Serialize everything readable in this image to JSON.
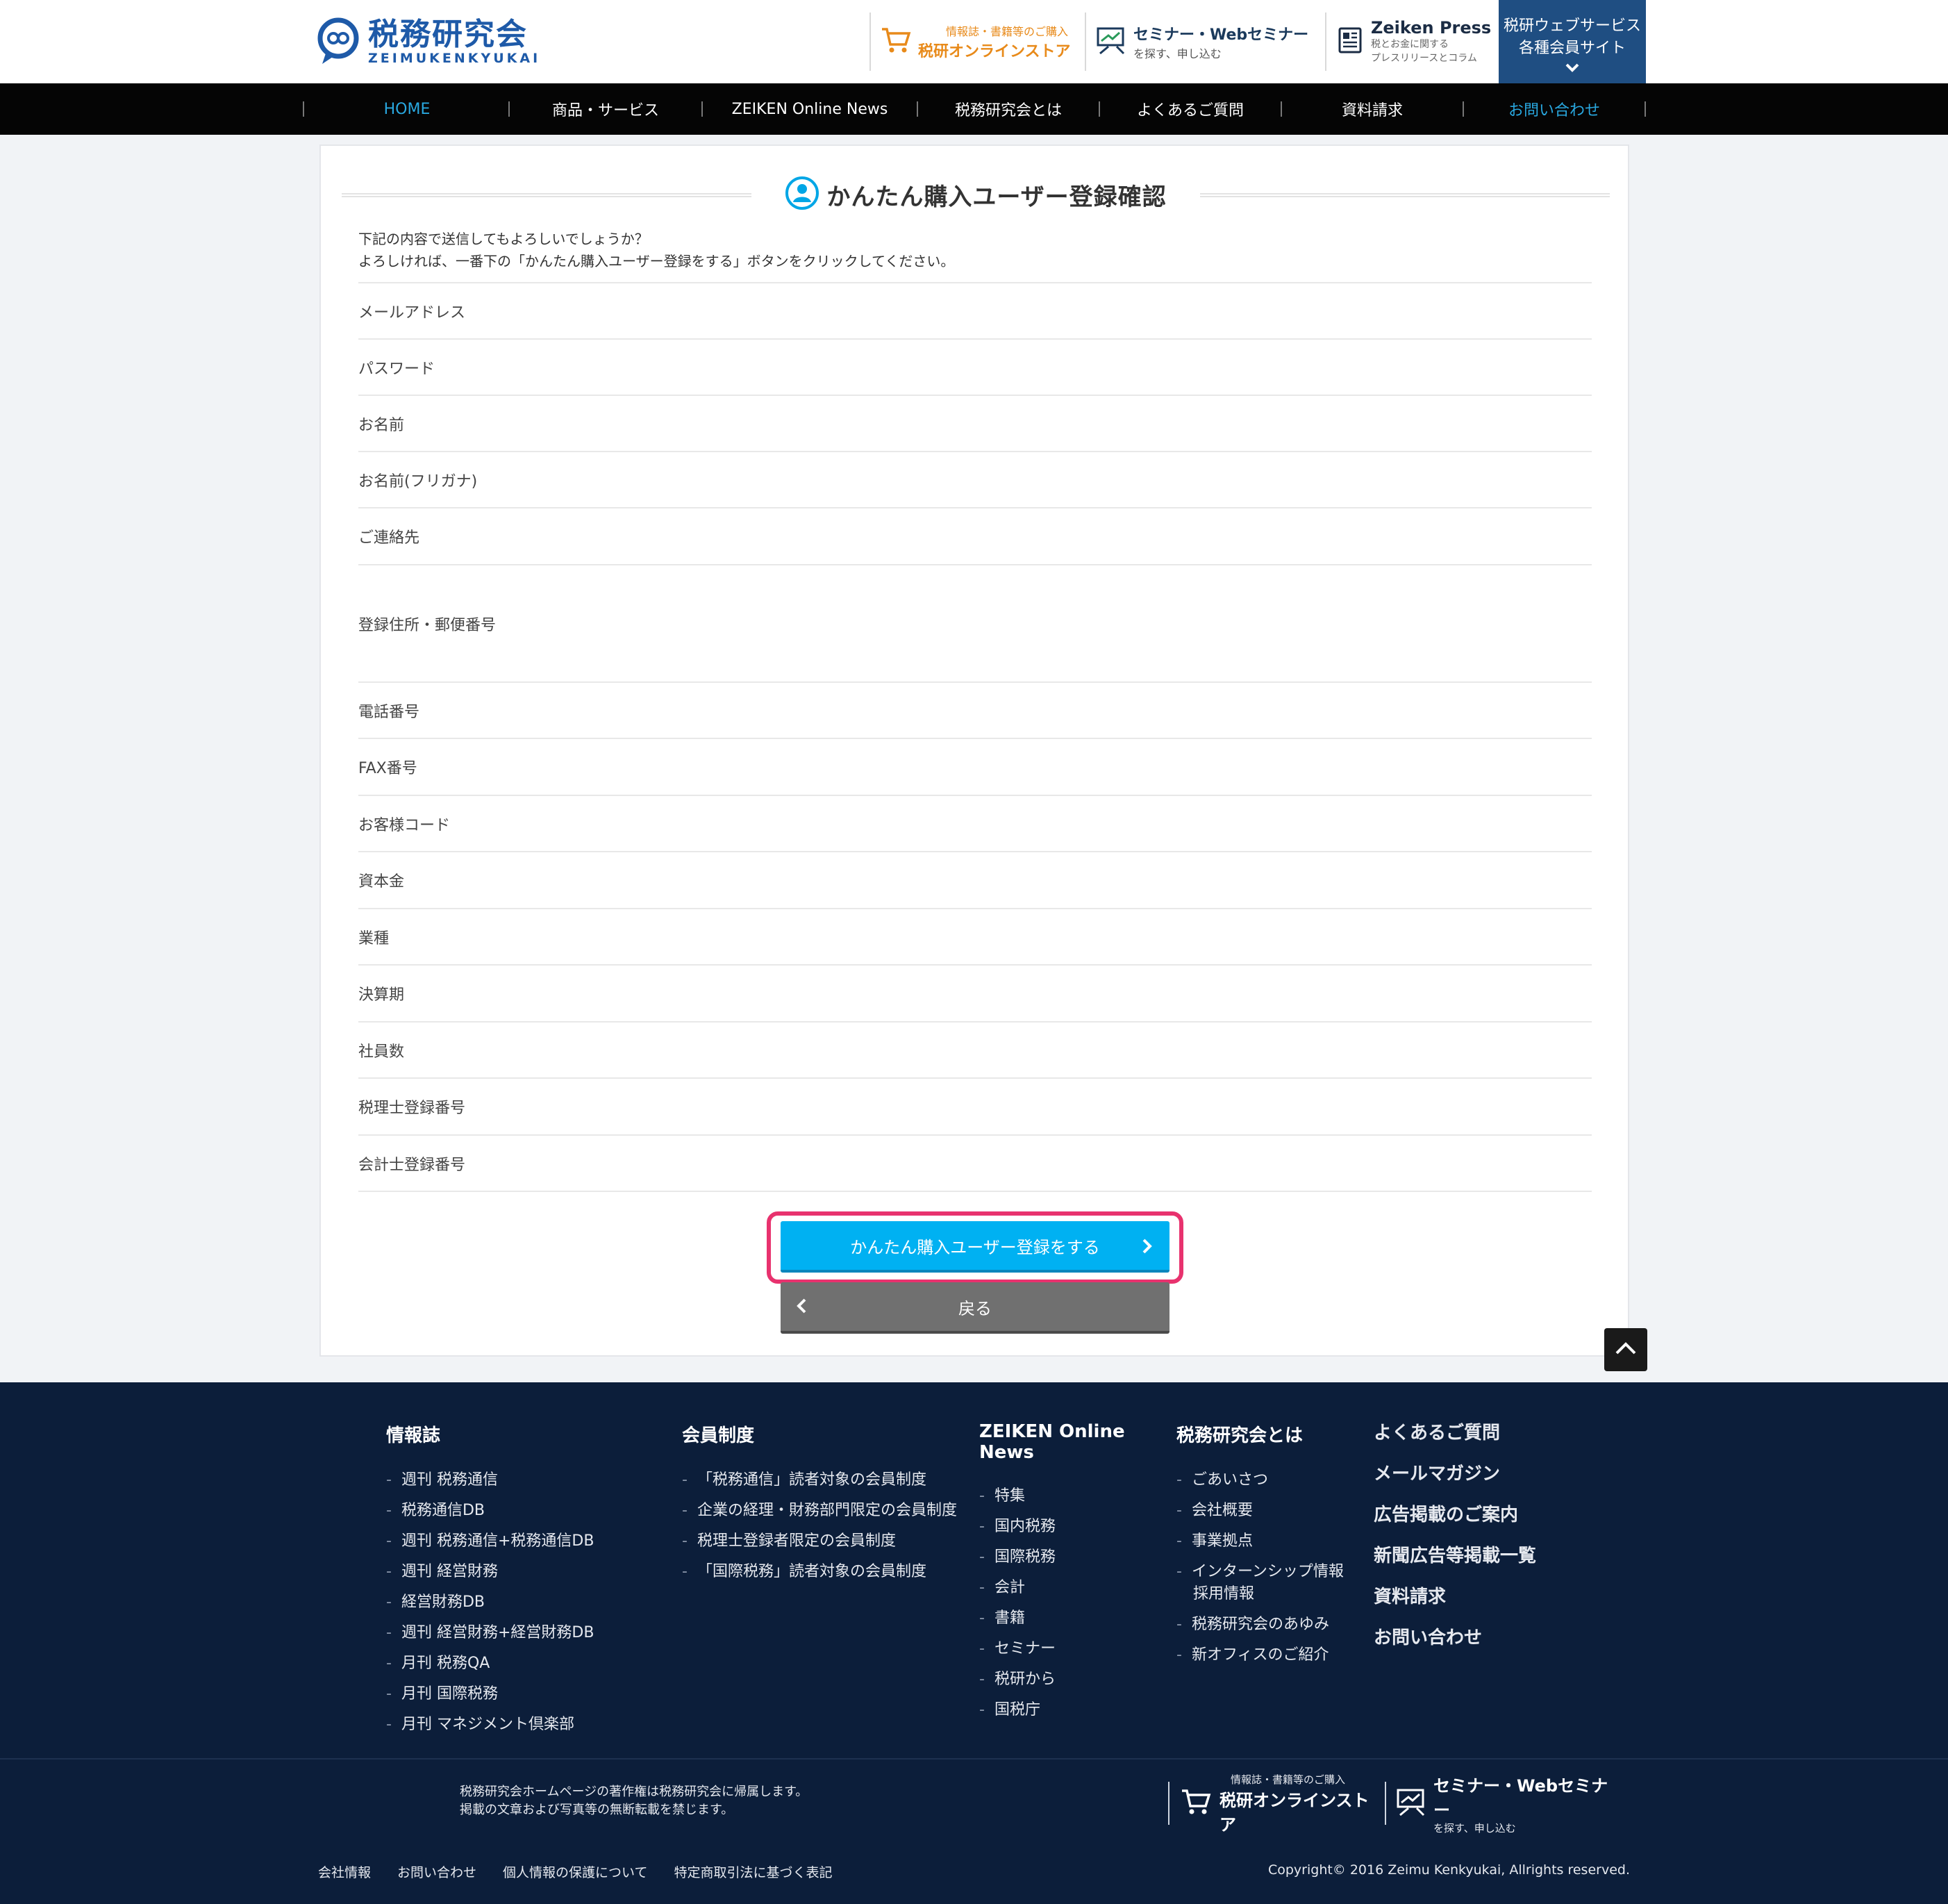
{
  "header": {
    "logo_jp": "税務研究会",
    "logo_en": "ZEIMUKENKYUKAI",
    "store_small": "情報誌・書籍等のご購入",
    "store_main": "税研オンラインストア",
    "seminar_main": "セミナー・Webセミナー",
    "seminar_small": "を探す、申し込む",
    "press_main": "Zeiken Press",
    "press_small1": "税とお金に関する",
    "press_small2": "プレスリリースとコラム",
    "web_line1": "税研ウェブサービス",
    "web_line2": "各種会員サイト"
  },
  "nav": [
    "HOME",
    "商品・サービス",
    "ZEIKEN Online News",
    "税務研究会とは",
    "よくあるご質問",
    "資料請求",
    "お問い合わせ"
  ],
  "main": {
    "title": "かんたん購入ユーザー登録確認",
    "intro1": "下記の内容で送信してもよろしいでしょうか？",
    "intro2": "よろしければ、一番下の「かんたん購入ユーザー登録をする」ボタンをクリックしてください。",
    "fields": [
      "メールアドレス",
      "パスワード",
      "お名前",
      "お名前(フリガナ)",
      "ご連絡先",
      "登録住所・郵便番号",
      "電話番号",
      "FAX番号",
      "お客様コード",
      "資本金",
      "業種",
      "決算期",
      "社員数",
      "税理士登録番号",
      "会計士登録番号"
    ],
    "submit_label": "かんたん購入ユーザー登録をする",
    "back_label": "戻る"
  },
  "footer": {
    "col1": {
      "title": "情報誌",
      "items": [
        "週刊 税務通信",
        "税務通信DB",
        "週刊 税務通信+税務通信DB",
        "週刊 経営財務",
        "経営財務DB",
        "週刊 経営財務+経営財務DB",
        "月刊 税務QA",
        "月刊 国際税務",
        "月刊 マネジメント倶楽部"
      ]
    },
    "col2": {
      "title": "会員制度",
      "items": [
        "「税務通信」読者対象の会員制度",
        "企業の経理・財務部門限定の会員制度",
        "税理士登録者限定の会員制度",
        "「国際税務」読者対象の会員制度"
      ]
    },
    "col3": {
      "title": "ZEIKEN Online News",
      "items": [
        "特集",
        "国内税務",
        "国際税務",
        "会計",
        "書籍",
        "セミナー",
        "税研から",
        "国税庁"
      ]
    },
    "col4": {
      "title": "税務研究会とは",
      "items": [
        "ごあいさつ",
        "会社概要",
        "事業拠点",
        "インターンシップ情報",
        "採用情報",
        "税務研究会のあゆみ",
        "新オフィスのご紹介"
      ]
    },
    "col5": {
      "items": [
        "よくあるご質問",
        "メールマガジン",
        "広告掲載のご案内",
        "新聞広告等掲載一覧",
        "資料請求",
        "お問い合わせ"
      ]
    },
    "note1": "税務研究会ホームページの著作権は税務研究会に帰属します。",
    "note2": "掲載の文章および写真等の無断転載を禁じます。",
    "store_small": "情報誌・書籍等のご購入",
    "store_main": "税研オンラインストア",
    "seminar_main": "セミナー・Webセミナー",
    "seminar_small": "を探す、申し込む",
    "links": [
      "会社情報",
      "お問い合わせ",
      "個人情報の保護について",
      "特定商取引法に基づく表記"
    ],
    "copyright": "Copyright© 2016 Zeimu Kenkyukai, Allrights reserved."
  },
  "colors": {
    "accent": "#00b1f2",
    "highlight": "#e8326e",
    "nav_bg": "#050505",
    "footer_bg": "#0c1e3a",
    "brand": "#1e5aa8"
  }
}
